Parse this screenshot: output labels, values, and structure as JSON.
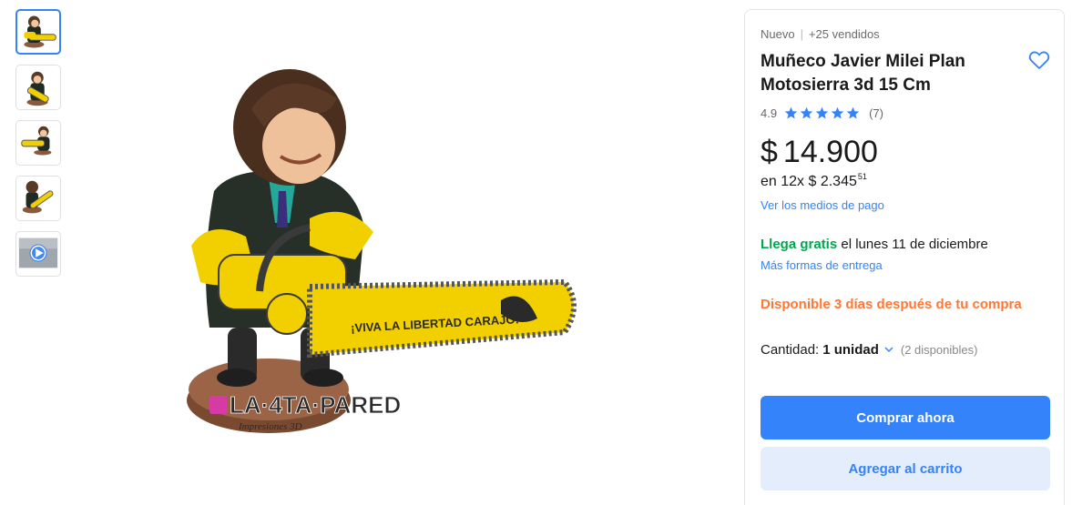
{
  "gallery": {
    "thumbnails": [
      {
        "name": "thumb-1",
        "active": true
      },
      {
        "name": "thumb-2",
        "active": false
      },
      {
        "name": "thumb-3",
        "active": false
      },
      {
        "name": "thumb-4",
        "active": false
      },
      {
        "name": "thumb-video",
        "active": false
      }
    ],
    "watermark_line1": "LA·4TA·PARED",
    "watermark_line2": "Impresiones 3D",
    "chainsaw_text": "¡VIVA LA LIBERTAD CARAJO!"
  },
  "product": {
    "condition": "Nuevo",
    "sold": "+25 vendidos",
    "title": "Muñeco Javier Milei Plan Motosierra 3d 15 Cm",
    "rating_value": "4.9",
    "rating_count": "(7)",
    "rating_stars": 5,
    "price_currency": "$",
    "price_amount": "14.900",
    "installments_prefix": "en 12x $ 2.345",
    "installments_cents": "51",
    "payment_link": "Ver los medios de pago"
  },
  "shipping": {
    "free_label": "Llega gratis",
    "date_text": " el lunes 11 de diciembre",
    "more_link": "Más formas de entrega",
    "availability": "Disponible 3 días después de tu compra"
  },
  "quantity": {
    "label": "Cantidad:",
    "value": "1 unidad",
    "stock": "(2 disponibles)"
  },
  "actions": {
    "buy_label": "Comprar ahora",
    "cart_label": "Agregar al carrito"
  },
  "colors": {
    "accent": "#3483fa",
    "free_shipping": "#00a650",
    "availability": "#ff7733"
  }
}
